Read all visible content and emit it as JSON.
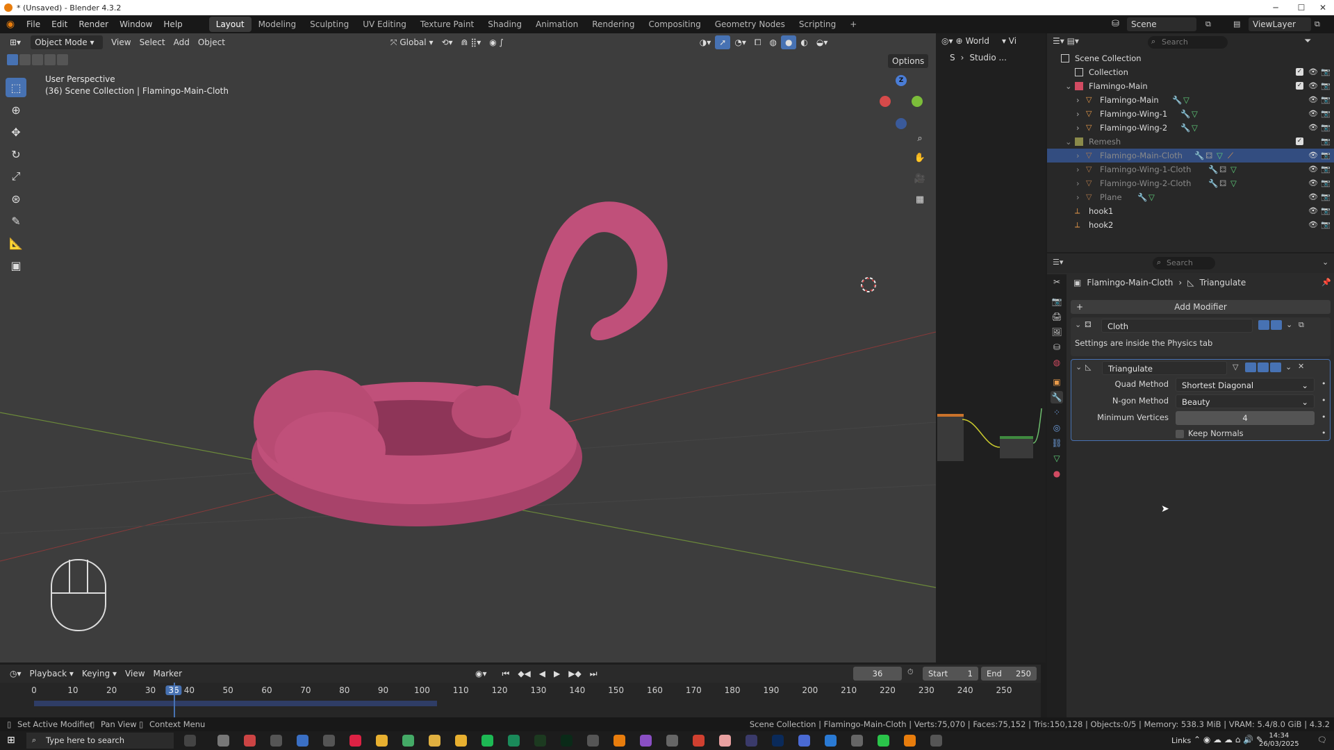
{
  "window": {
    "title": "* (Unsaved) - Blender 4.3.2",
    "min": "─",
    "max": "☐",
    "close": "✕"
  },
  "menubar": {
    "items": [
      "File",
      "Edit",
      "Render",
      "Window",
      "Help"
    ],
    "workspaces": [
      "Layout",
      "Modeling",
      "Sculpting",
      "UV Editing",
      "Texture Paint",
      "Shading",
      "Animation",
      "Rendering",
      "Compositing",
      "Geometry Nodes",
      "Scripting"
    ],
    "active_workspace": "Layout",
    "add_tab": "+",
    "scene": "Scene",
    "view_layer": "ViewLayer"
  },
  "viewport": {
    "mode": "Object Mode",
    "menus": [
      "View",
      "Select",
      "Add",
      "Object"
    ],
    "transform_orientation": "Global",
    "options": "Options",
    "perspective": "User Perspective",
    "context": "(36) Scene Collection | Flamingo-Main-Cloth",
    "gizmo_axis": "Z"
  },
  "node_panel": {
    "world": "World",
    "crumb_s": "S",
    "crumb_studio": "Studio ..."
  },
  "outliner": {
    "search_placeholder": "Search",
    "rows": [
      {
        "label": "Scene Collection"
      },
      {
        "label": "Collection"
      },
      {
        "label": "Flamingo-Main"
      },
      {
        "label": "Flamingo-Main"
      },
      {
        "label": "Flamingo-Wing-1"
      },
      {
        "label": "Flamingo-Wing-2"
      },
      {
        "label": "Remesh"
      },
      {
        "label": "Flamingo-Main-Cloth"
      },
      {
        "label": "Flamingo-Wing-1-Cloth"
      },
      {
        "label": "Flamingo-Wing-2-Cloth"
      },
      {
        "label": "Plane"
      },
      {
        "label": "hook1"
      },
      {
        "label": "hook2"
      }
    ]
  },
  "properties": {
    "search_placeholder": "Search",
    "breadcrumb_object": "Flamingo-Main-Cloth",
    "breadcrumb_modifier": "Triangulate",
    "add_modifier": "Add Modifier",
    "cloth_name": "Cloth",
    "cloth_note": "Settings are inside the Physics tab",
    "triangulate_name": "Triangulate",
    "quad_method_label": "Quad Method",
    "quad_method_value": "Shortest Diagonal",
    "ngon_method_label": "N-gon Method",
    "ngon_method_value": "Beauty",
    "min_vertices_label": "Minimum Vertices",
    "min_vertices_value": "4",
    "keep_normals_label": "Keep Normals"
  },
  "timeline": {
    "menus": [
      "Playback",
      "Keying",
      "View",
      "Marker"
    ],
    "current_frame": "36",
    "start_label": "Start",
    "start_value": "1",
    "end_label": "End",
    "end_value": "250",
    "ticks": [
      "0",
      "10",
      "20",
      "30",
      "36",
      "40",
      "50",
      "60",
      "70",
      "80",
      "90",
      "100",
      "110",
      "120",
      "130",
      "140",
      "150",
      "160",
      "170",
      "180",
      "190",
      "200",
      "210",
      "220",
      "230",
      "240",
      "250"
    ]
  },
  "statusbar": {
    "set_active": "Set Active Modifier",
    "pan_view": "Pan View",
    "context_menu": "Context Menu",
    "stats": "Scene Collection | Flamingo-Main-Cloth | Verts:75,070 | Faces:75,152 | Tris:150,128 | Objects:0/5 | Memory: 538.3 MiB | VRAM: 5.4/8.0 GiB | 4.3.2"
  },
  "taskbar": {
    "search_placeholder": "Type here to search",
    "links": "Links",
    "time": "14:34",
    "date": "26/03/2025"
  },
  "colors": {
    "accent": "#4772b3",
    "selection": "#334d80",
    "flamingo": "#c0507a",
    "taskbar": "#1c1c1c"
  }
}
